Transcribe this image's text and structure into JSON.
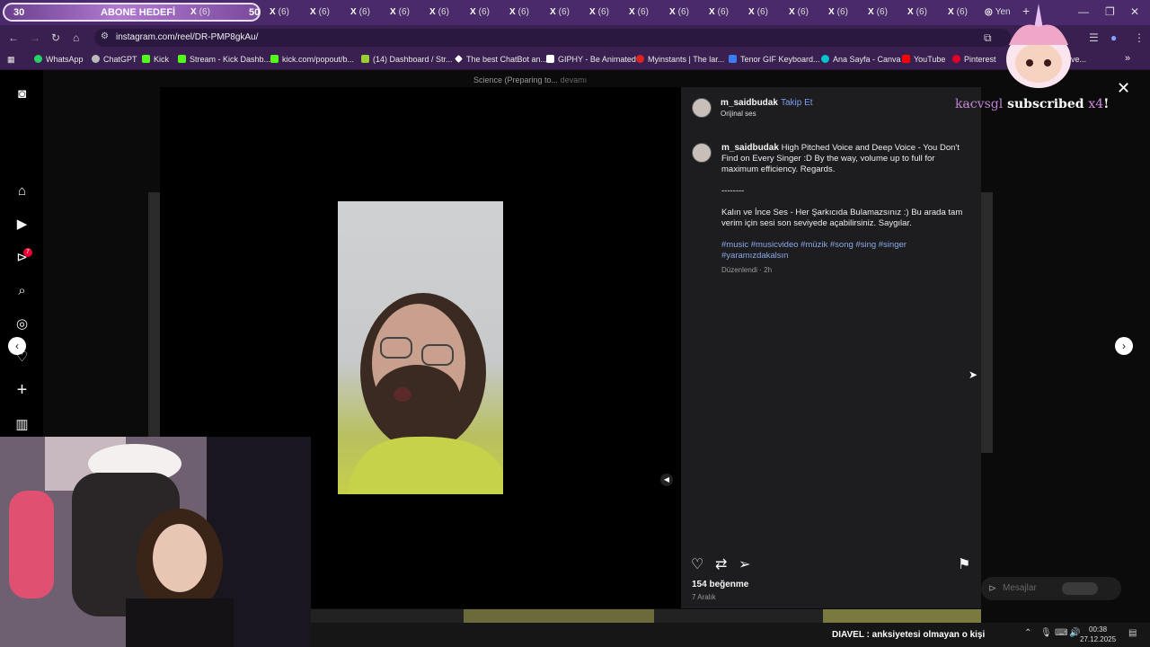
{
  "browser": {
    "goal_banner": {
      "count": "30",
      "label": "ABONE HEDEFİ",
      "target": "50"
    },
    "tab_label": "(6)",
    "new_tab_label": "Yen",
    "url": "instagram.com/reel/DR-PMP8gkAu/",
    "bookmarks": [
      {
        "label": "WhatsApp",
        "color": "#25d366"
      },
      {
        "label": "ChatGPT",
        "color": "#bbbbbb"
      },
      {
        "label": "Kick",
        "color": "#53fc18"
      },
      {
        "label": "Stream - Kick Dashb...",
        "color": "#53fc18"
      },
      {
        "label": "kick.com/popout/b...",
        "color": "#53fc18"
      },
      {
        "label": "(14) Dashboard / Str...",
        "color": "#9acd32"
      },
      {
        "label": "The best ChatBot an...",
        "color": "#ffffff"
      },
      {
        "label": "GIPHY - Be Animated",
        "color": "#ffffff"
      },
      {
        "label": "Myinstants | The lar...",
        "color": "#d22"
      },
      {
        "label": "Tenor GIF Keyboard...",
        "color": "#3b7cf0"
      },
      {
        "label": "Ana Sayfa - Canva",
        "color": "#00c4cc"
      },
      {
        "label": "YouTube",
        "color": "#ff0000"
      },
      {
        "label": "Pinterest",
        "color": "#e60023"
      },
      {
        "label": "ve...",
        "color": "#888888"
      }
    ]
  },
  "overlay": {
    "preparing_text": "Science (Preparing to...",
    "preparing_more": "devamı",
    "subscriber_alert": {
      "user": "kacvsgl",
      "text": "subscribed",
      "multiplier": "x4",
      "bang": "!"
    },
    "notification_badge": "7"
  },
  "post": {
    "username": "m_saidbudak",
    "follow_label": "Takip Et",
    "audio_label": "Orijinal ses",
    "caption_en": "High Pitched Voice and Deep Voice - You Don't Find on Every Singer :D By the way, volume up to full for maximum efficiency. Regards.",
    "separator": "--------",
    "caption_tr": "Kalın ve İnce Ses - Her Şarkıcıda Bulamazsınız :) Bu arada tam verim için sesi son seviyede açabilirsiniz. Saygılar.",
    "hashtags": "#music #musicvideo #müzik #song #sing #singer #yaramızdakalsın",
    "edited": "Düzenlendi · 2h",
    "likes": "154 beğenme",
    "date": "7 Aralık",
    "messages_label": "Mesajlar"
  },
  "taskbar": {
    "ticker": "DIAVEL : anksiyetesi olmayan o kişi",
    "time": "00:38",
    "date": "27.12.2025"
  }
}
